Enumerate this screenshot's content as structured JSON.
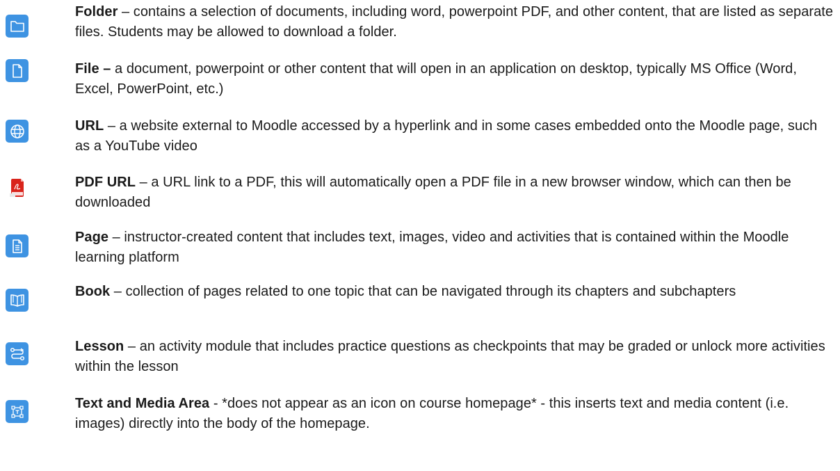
{
  "entries": [
    {
      "term": "Folder",
      "description": " – contains a selection of documents, including word, powerpoint PDF, and other content, that are listed as separate files. Students may be allowed to download a folder.",
      "icon": "folder-icon"
    },
    {
      "term": "File –",
      "description": " a document, powerpoint or other content that will open in an application on desktop, typically MS Office (Word, Excel, PowerPoint, etc.)",
      "icon": "file-icon"
    },
    {
      "term": "URL",
      "description": " – a website external to Moodle accessed by a hyperlink and in some cases embedded onto the Moodle page, such as a YouTube video",
      "icon": "globe-icon"
    },
    {
      "term": "PDF URL",
      "description": " – a URL link to a PDF, this will automatically open a PDF file in a new browser window, which can then be downloaded",
      "icon": "pdf-icon"
    },
    {
      "term": "Page",
      "description": " – instructor-created content that includes text, images, video and activities that is contained within the Moodle learning platform",
      "icon": "page-icon"
    },
    {
      "term": "Book",
      "description": " – collection of pages related to one topic that can be navigated through its chapters and subchapters",
      "icon": "book-icon"
    },
    {
      "term": "Lesson",
      "description": " – an activity module that includes practice questions as checkpoints that may be graded or unlock more activities within the lesson",
      "icon": "lesson-icon"
    },
    {
      "term": "Text and Media Area",
      "description": " - *does not appear as an icon on course homepage* - this inserts text and media content (i.e. images) directly into the body of the homepage.",
      "icon": "text-media-area-icon"
    }
  ],
  "colors": {
    "icon_background": "#3e93e2",
    "icon_foreground": "#ffffff",
    "pdf_red": "#d9241c",
    "text": "#1a1a1a"
  }
}
